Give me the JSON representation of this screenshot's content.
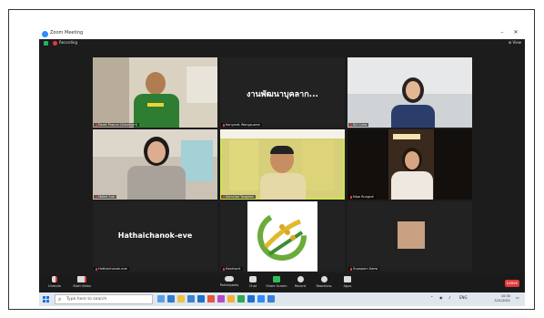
{
  "window": {
    "title": "Zoom Meeting"
  },
  "recording": {
    "label": "Recording",
    "view_label": "View"
  },
  "tiles": [
    {
      "name": "Naret Prapun (Kasetsart)"
    },
    {
      "name": "Kanyarat Wongsuwan",
      "display_text": "งานพัฒนาบุคลาก..."
    },
    {
      "name": "Siri Luna"
    },
    {
      "name": "Malee Suk"
    },
    {
      "name": "Somchai Tongdee"
    },
    {
      "name": "Nipa Rungrot"
    },
    {
      "name": "Hathaichanok-eve",
      "display_text": "Hathaichanok-eve"
    },
    {
      "name": "Kasetsart"
    },
    {
      "name": "Supaporn Kaew"
    }
  ],
  "toolbar": {
    "unmute": "Unmute",
    "start_video": "Start Video",
    "participants": "Participants",
    "participants_count": "9",
    "chat": "Chat",
    "share_screen": "Share Screen",
    "record": "Record",
    "reactions": "Reactions",
    "apps": "Apps",
    "leave": "Leave"
  },
  "taskbar": {
    "search_placeholder": "Type here to search",
    "time": "10:30",
    "date": "7/21/2021",
    "lang": "ENG"
  },
  "colors": {
    "active_speaker": "#c8e64c",
    "leave": "#e03a3a",
    "share_green": "#2fbf5a",
    "logo_green": "#6aab3a"
  }
}
